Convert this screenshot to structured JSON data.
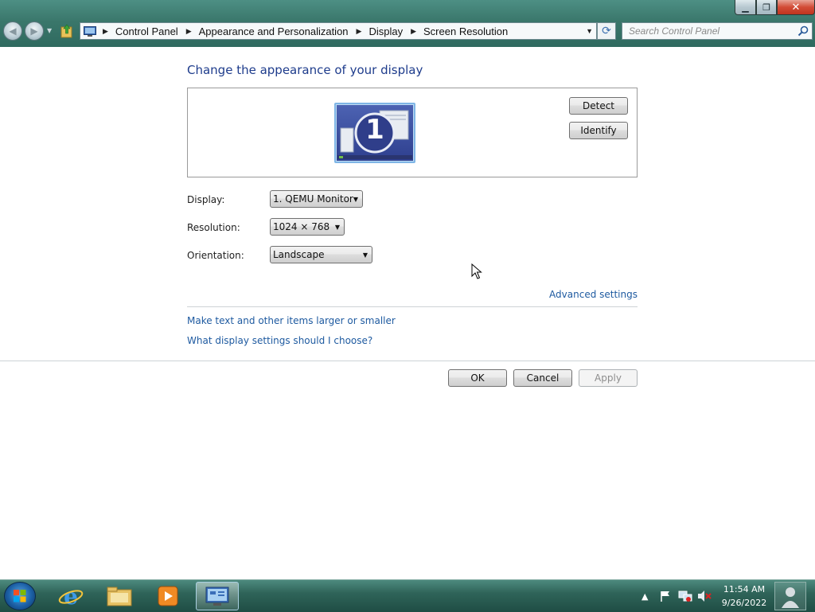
{
  "window": {
    "controls": {
      "minimize": "minimize-icon",
      "maximize": "restore-icon",
      "close": "close-icon"
    }
  },
  "address_bar": {
    "breadcrumbs": [
      "Control Panel",
      "Appearance and Personalization",
      "Display",
      "Screen Resolution"
    ],
    "icon": "control-panel-icon"
  },
  "search": {
    "placeholder": "Search Control Panel",
    "value": ""
  },
  "page": {
    "heading": "Change the appearance of your display",
    "monitor_number": "1",
    "detect_label": "Detect",
    "identify_label": "Identify",
    "display_label": "Display:",
    "display_value": "1. QEMU Monitor",
    "resolution_label": "Resolution:",
    "resolution_value": "1024 × 768",
    "orientation_label": "Orientation:",
    "orientation_value": "Landscape",
    "advanced_link": "Advanced settings",
    "text_size_link": "Make text and other items larger or smaller",
    "help_link": "What display settings should I choose?",
    "ok_label": "OK",
    "cancel_label": "Cancel",
    "apply_label": "Apply"
  },
  "taskbar": {
    "pinned": [
      "start-orb-icon",
      "internet-explorer-icon",
      "file-explorer-icon",
      "media-player-icon",
      "control-panel-icon"
    ],
    "active_item": "control-panel-icon",
    "clock_time": "11:54 AM",
    "clock_date": "9/26/2022",
    "tray_icons": [
      "show-hidden-icons",
      "action-center-flag-icon",
      "network-icon",
      "volume-muted-icon"
    ]
  },
  "colors": {
    "heading": "#1e3c8c",
    "link": "#1e5aa0",
    "titlebar": "#3f7c6f",
    "taskbar": "#2f6459"
  }
}
